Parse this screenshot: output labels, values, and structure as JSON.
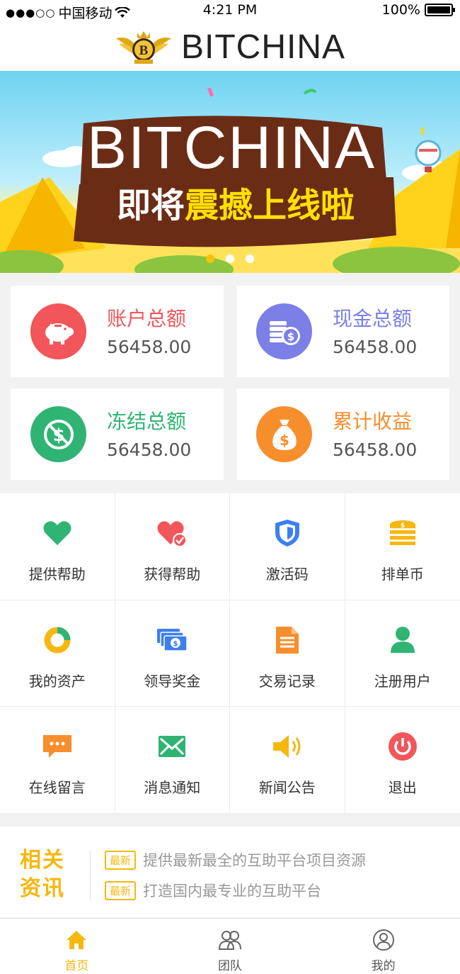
{
  "status_bar": {
    "carrier": "中国移动",
    "time": "4:21 PM",
    "battery": "100%",
    "battery_level": 1.0
  },
  "header": {
    "brand_bold": "BIT",
    "brand_light": "CHINA",
    "logo_icon": "crown-b-badge-icon"
  },
  "banner": {
    "title": "BITCHINA",
    "subtitle_a": "即将",
    "subtitle_b": "震撼",
    "subtitle_c": "上线啦",
    "active_slide": 1,
    "slide_count": 3
  },
  "stats": [
    {
      "label": "账户总额",
      "value": "56458.00",
      "color": "#f2555a",
      "icon": "piggy-bank-icon"
    },
    {
      "label": "现金总额",
      "value": "56458.00",
      "color": "#7b7fe6",
      "icon": "coins-dollar-icon"
    },
    {
      "label": "冻结总额",
      "value": "56458.00",
      "color": "#2fb473",
      "icon": "no-dollar-icon"
    },
    {
      "label": "累计收益",
      "value": "56458.00",
      "color": "#f78e2c",
      "icon": "money-bag-icon"
    }
  ],
  "menu": [
    {
      "label": "提供帮助",
      "icon": "heart-icon",
      "color": "#2fb473"
    },
    {
      "label": "获得帮助",
      "icon": "heart-check-icon",
      "color": "#f2555a"
    },
    {
      "label": "激活码",
      "icon": "shield-icon",
      "color": "#3c7ff0"
    },
    {
      "label": "排单币",
      "icon": "coin-stack-icon",
      "color": "#f6b70f"
    },
    {
      "label": "我的资产",
      "icon": "donut-chart-icon",
      "color": "#f6b70f"
    },
    {
      "label": "领导奖金",
      "icon": "cash-stack-icon",
      "color": "#3c7ff0"
    },
    {
      "label": "交易记录",
      "icon": "document-icon",
      "color": "#f78e2c"
    },
    {
      "label": "注册用户",
      "icon": "user-icon",
      "color": "#2fb473"
    },
    {
      "label": "在线留言",
      "icon": "chat-bubble-icon",
      "color": "#f78e2c"
    },
    {
      "label": "消息通知",
      "icon": "envelope-icon",
      "color": "#2fb473"
    },
    {
      "label": "新闻公告",
      "icon": "speaker-icon",
      "color": "#f6b70f"
    },
    {
      "label": "退出",
      "icon": "power-icon",
      "color": "#f2555a"
    }
  ],
  "news": {
    "title_line1": "相关",
    "title_line2": "资讯",
    "items": [
      {
        "badge": "最新",
        "text": "提供最新最全的互助平台项目资源"
      },
      {
        "badge": "最新",
        "text": "打造国内最专业的互助平台"
      }
    ]
  },
  "tabbar": [
    {
      "label": "首页",
      "icon": "home-icon",
      "active": true
    },
    {
      "label": "团队",
      "icon": "team-icon",
      "active": false
    },
    {
      "label": "我的",
      "icon": "profile-icon",
      "active": false
    }
  ],
  "colors": {
    "accent": "#f6b70f"
  }
}
